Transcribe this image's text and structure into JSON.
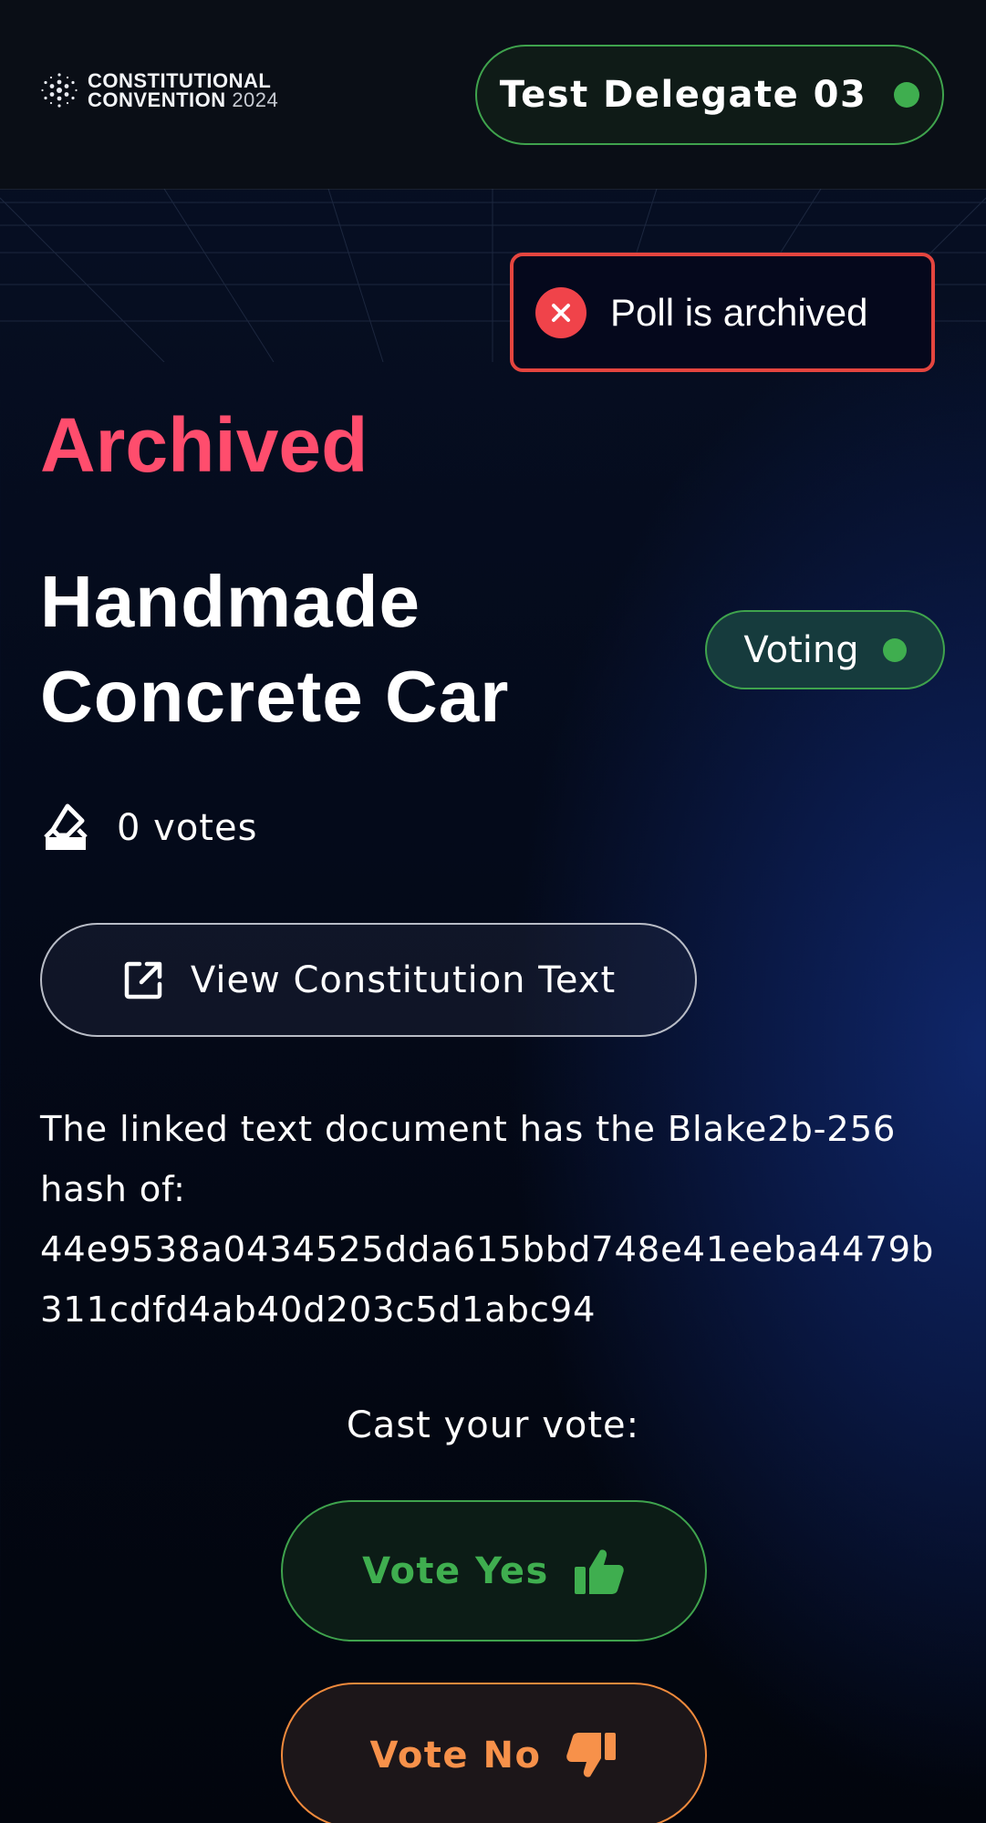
{
  "header": {
    "logo_line1": "CONSTITUTIONAL",
    "logo_line2": "CONVENTION",
    "logo_year": "2024",
    "delegate_name": "Test Delegate 03",
    "status_color": "#3fae4f"
  },
  "toast": {
    "message": "Poll is archived",
    "icon": "close-circle-icon",
    "color": "#f0434a"
  },
  "poll": {
    "state_label": "Archived",
    "title": "Handmade Concrete Car",
    "status_badge": "Voting",
    "votes_label": "0 votes",
    "votes_icon": "ballot-box-icon",
    "view_button_label": "View Constitution Text",
    "view_button_icon": "external-link-icon",
    "hash_intro": "The linked text document has the Blake2b-256 hash of:",
    "hash_value": "44e9538a0434525dda615bbd748e41eeba4479b311cdfd4ab40d203c5d1abc94"
  },
  "vote": {
    "prompt": "Cast your vote:",
    "yes_label": "Vote Yes",
    "yes_icon": "thumbs-up-icon",
    "yes_color": "#3fae4f",
    "no_label": "Vote No",
    "no_icon": "thumbs-down-icon",
    "no_color": "#f7914a"
  },
  "theme": {
    "archived_color": "#ff4d6d"
  }
}
